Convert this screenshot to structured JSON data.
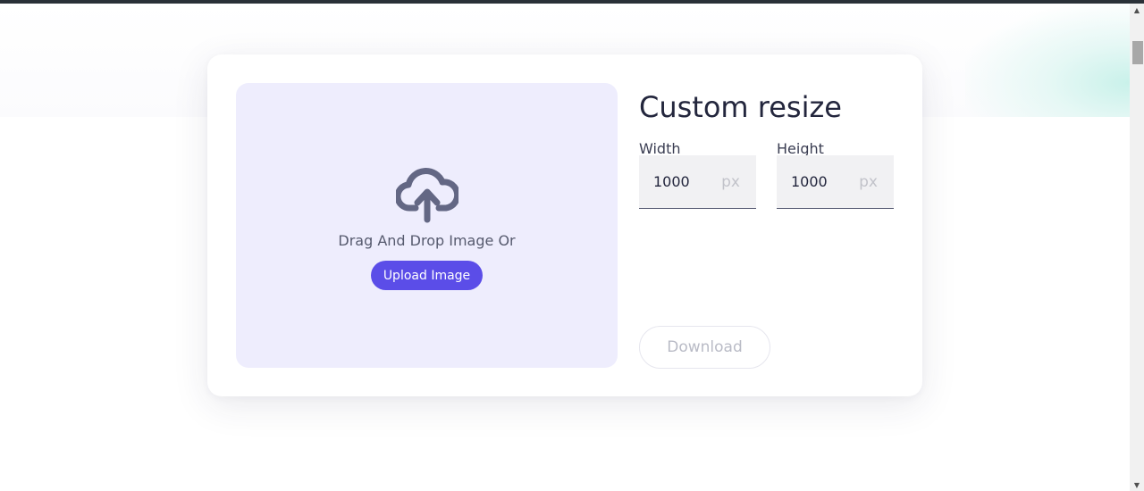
{
  "upload": {
    "drop_text": "Drag And Drop Image Or",
    "button_label": "Upload Image"
  },
  "resize": {
    "title": "Custom resize",
    "width_label": "Width",
    "width_value": "1000",
    "width_unit": "px",
    "height_label": "Height",
    "height_value": "1000",
    "height_unit": "px",
    "download_label": "Download"
  },
  "colors": {
    "accent": "#5b4de8",
    "dropzone_bg": "#eeedfd",
    "title": "#23263d"
  },
  "icons": {
    "upload": "cloud-upload-icon"
  }
}
